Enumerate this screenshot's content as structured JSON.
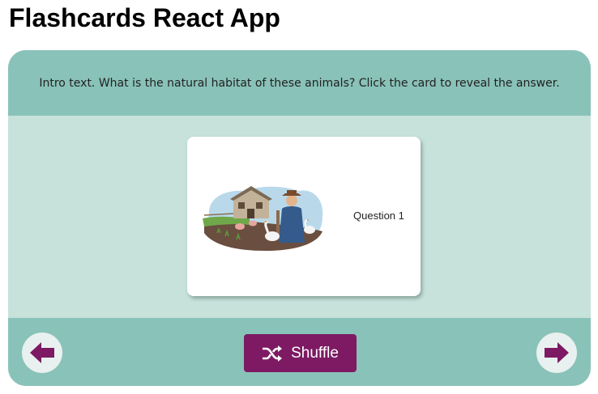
{
  "app": {
    "title": "Flashcards React App"
  },
  "intro": {
    "text": "Intro text. What is the natural habitat of these animals? Click the card to reveal the answer."
  },
  "card": {
    "label": "Question 1",
    "image_icon": "farm-illustration-icon"
  },
  "controls": {
    "prev_icon": "arrow-left-icon",
    "next_icon": "arrow-right-icon",
    "shuffle_label": "Shuffle",
    "shuffle_icon": "shuffle-icon"
  },
  "colors": {
    "panel_band": "#89c2b8",
    "panel_body": "#c6e2db",
    "accent": "#7d1a63"
  }
}
